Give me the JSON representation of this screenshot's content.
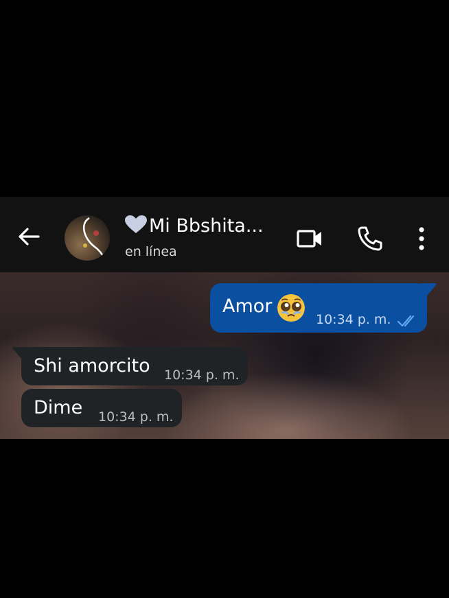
{
  "header": {
    "contact_name": "Mi Bbshita...",
    "status": "en línea",
    "heart_color": "#c9cfe3",
    "icons": {
      "back": "arrow-left-icon",
      "video": "video-camera-icon",
      "call": "phone-icon",
      "menu": "more-vert-icon"
    }
  },
  "messages": [
    {
      "direction": "outgoing",
      "text": "Amor",
      "emoji": "pleading-face-emoji",
      "time": "10:34 p. m.",
      "read_status": "double-check-read"
    },
    {
      "direction": "incoming",
      "text": "Shi amorcito",
      "time": "10:34 p. m."
    },
    {
      "direction": "incoming",
      "text": "Dime",
      "time": "10:34 p. m."
    }
  ],
  "colors": {
    "outgoing_bubble": "#0b4fa0",
    "incoming_bubble": "#1f2326",
    "app_bar": "#121212",
    "read_ticks": "#5ea8f0"
  }
}
